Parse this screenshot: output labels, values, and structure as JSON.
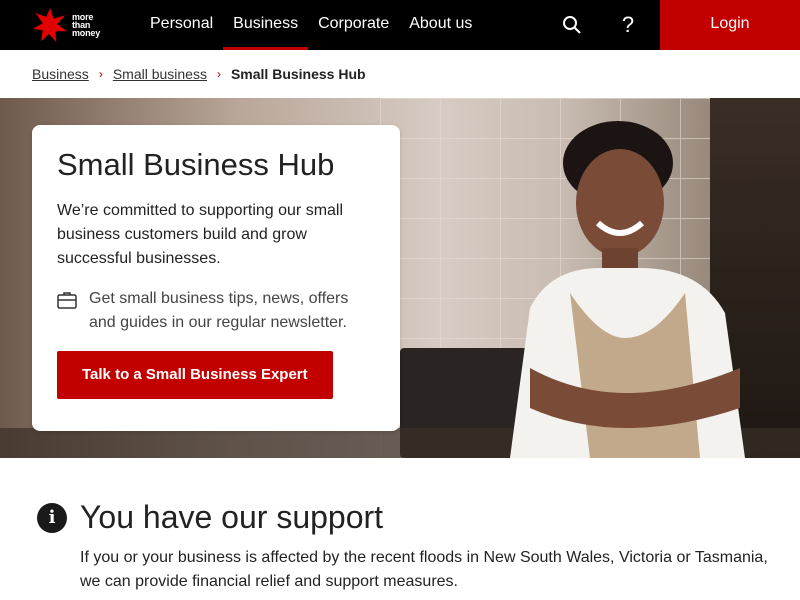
{
  "header": {
    "logo_alt": "NAB",
    "logo_tagline": [
      "more",
      "than",
      "money"
    ],
    "nav_items": [
      "Personal",
      "Business",
      "Corporate",
      "About us"
    ],
    "active_nav": "Business",
    "search_icon": "search-icon",
    "help_icon": "help-icon",
    "help_glyph": "?",
    "login_label": "Login"
  },
  "breadcrumb": {
    "items": [
      "Business",
      "Small business"
    ],
    "current": "Small Business Hub",
    "separator": "›"
  },
  "hero": {
    "title": "Small Business Hub",
    "description": "We’re committed to supporting our small business customers build and grow successful businesses.",
    "tip_icon": "briefcase-icon",
    "tip_text": "Get small business tips, news, offers and guides in our regular newsletter.",
    "cta_label": "Talk to a Small Business Expert"
  },
  "support": {
    "icon": "info-icon",
    "icon_glyph": "i",
    "title": "You have our support",
    "text": "If you or your business is affected by the recent floods in New South Wales, Victoria or Tasmania, we can provide financial relief and support measures."
  },
  "colors": {
    "brand_red": "#c20000",
    "header_bg": "#000000",
    "text": "#222222"
  }
}
